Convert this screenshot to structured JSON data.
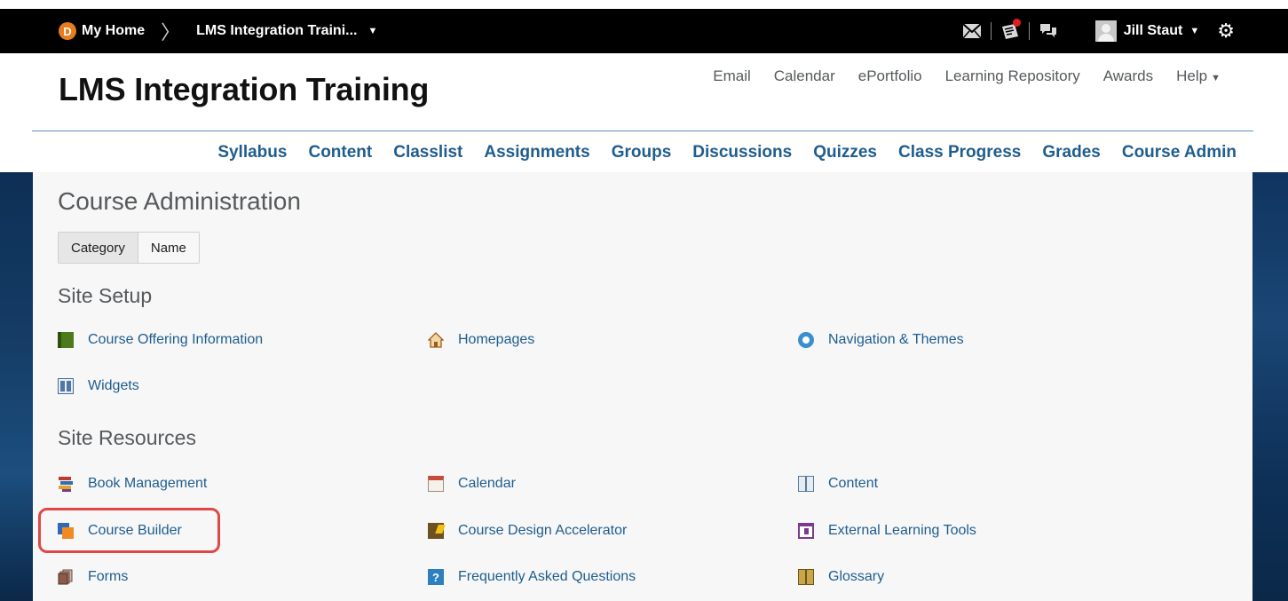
{
  "minibar": {
    "home_label": "My Home",
    "home_logo_letter": "D",
    "course_label": "LMS Integration Traini...",
    "user_name": "Jill Staut"
  },
  "header": {
    "course_title": "LMS Integration Training",
    "links": [
      "Email",
      "Calendar",
      "ePortfolio",
      "Learning Repository",
      "Awards",
      "Help"
    ]
  },
  "navbar": {
    "items": [
      "Syllabus",
      "Content",
      "Classlist",
      "Assignments",
      "Groups",
      "Discussions",
      "Quizzes",
      "Class Progress",
      "Grades",
      "Course Admin"
    ]
  },
  "page": {
    "title": "Course Administration",
    "view_toggle": {
      "category_label": "Category",
      "name_label": "Name",
      "selected": "Category"
    }
  },
  "sections": {
    "site_setup": {
      "title": "Site Setup",
      "items": [
        {
          "label": "Course Offering Information",
          "icon": "green-book-icon"
        },
        {
          "label": "Homepages",
          "icon": "house-icon"
        },
        {
          "label": "Navigation & Themes",
          "icon": "compass-icon"
        },
        {
          "label": "Widgets",
          "icon": "widgets-icon"
        }
      ]
    },
    "site_resources": {
      "title": "Site Resources",
      "items": [
        {
          "label": "Book Management",
          "icon": "books-stack-icon"
        },
        {
          "label": "Calendar",
          "icon": "calendar-icon"
        },
        {
          "label": "Content",
          "icon": "open-book-icon"
        },
        {
          "label": "Course Builder",
          "icon": "course-builder-icon"
        },
        {
          "label": "Course Design Accelerator",
          "icon": "design-accelerator-icon"
        },
        {
          "label": "External Learning Tools",
          "icon": "external-tools-icon"
        },
        {
          "label": "Forms",
          "icon": "forms-icon"
        },
        {
          "label": "Frequently Asked Questions",
          "icon": "faq-icon"
        },
        {
          "label": "Glossary",
          "icon": "glossary-icon"
        }
      ]
    }
  },
  "colors": {
    "link": "#1f5d8e",
    "minibar_bg": "#000000",
    "highlight_border": "#e04848",
    "notification_dot": "#e01c1c"
  }
}
